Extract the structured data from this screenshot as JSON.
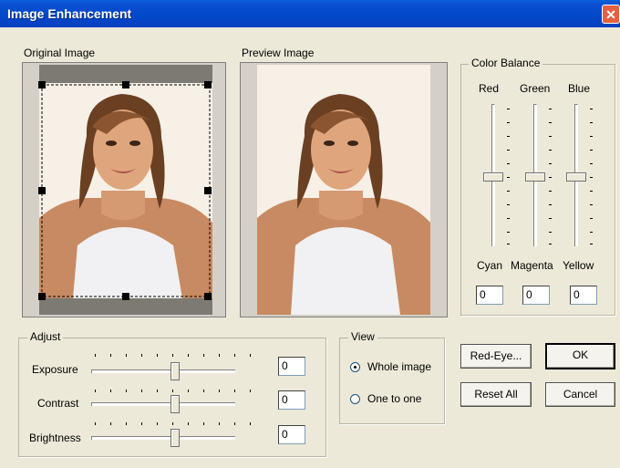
{
  "window": {
    "title": "Image Enhancement",
    "close_glyph": "✕"
  },
  "original": {
    "label": "Original Image"
  },
  "preview": {
    "label": "Preview Image"
  },
  "color_balance": {
    "title": "Color Balance",
    "top_labels": [
      "Red",
      "Green",
      "Blue"
    ],
    "bottom_labels": [
      "Cyan",
      "Magenta",
      "Yellow"
    ],
    "values": [
      "0",
      "0",
      "0"
    ]
  },
  "adjust": {
    "title": "Adjust",
    "rows": [
      {
        "label": "Exposure",
        "value": "0"
      },
      {
        "label": "Contrast",
        "value": "0"
      },
      {
        "label": "Brightness",
        "value": "0"
      }
    ]
  },
  "view": {
    "title": "View",
    "options": [
      "Whole image",
      "One to one"
    ],
    "selected": "Whole image"
  },
  "buttons": {
    "red_eye": "Red-Eye...",
    "ok": "OK",
    "reset_all": "Reset All",
    "cancel": "Cancel"
  },
  "colors": {
    "title_bar": "#0a4fd0",
    "dialog_bg": "#ece9d8",
    "close_button": "#e2613f"
  }
}
